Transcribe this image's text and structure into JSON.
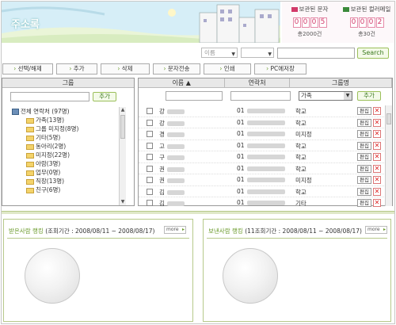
{
  "app": {
    "title": "주소록"
  },
  "counters": [
    {
      "label": "보관된 문자",
      "digits": [
        "0",
        "0",
        "0",
        "5"
      ],
      "summary": "총2000건"
    },
    {
      "label": "보관된 컬러메일",
      "digits": [
        "0",
        "0",
        "0",
        "2"
      ],
      "summary": "총30건"
    }
  ],
  "search": {
    "field_selected": "이름",
    "type_selected": "",
    "query": "",
    "button": "Search"
  },
  "toolbar": [
    "선택/해제",
    "추가",
    "삭제",
    "문자전송",
    "인쇄",
    "PC에저장"
  ],
  "group_panel": {
    "header": "그룹",
    "add_button": "추가",
    "root": "전체 연락처 (97명)",
    "groups": [
      "가족(13명)",
      "그룹 미지정(8명)",
      "기타(5명)",
      "동아리(2명)",
      "미지정(22명)",
      "아람(3명)",
      "업무(0명)",
      "직장(13명)",
      "친구(6명)"
    ]
  },
  "contacts": {
    "columns": [
      "이름 ▲",
      "연락처",
      "그룹명"
    ],
    "group_filter": "가족",
    "add_button": "추가",
    "edit_label": "편집",
    "delete_label": "✕",
    "rows": [
      {
        "name": "강",
        "phone": "01",
        "group": "학교"
      },
      {
        "name": "강",
        "phone": "01",
        "group": "학교"
      },
      {
        "name": "경",
        "phone": "01",
        "group": "미지정"
      },
      {
        "name": "고",
        "phone": "01",
        "group": "학교"
      },
      {
        "name": "구",
        "phone": "01",
        "group": "학교"
      },
      {
        "name": "권",
        "phone": "01",
        "group": "학교"
      },
      {
        "name": "권",
        "phone": "01",
        "group": "미지정"
      },
      {
        "name": "김",
        "phone": "01",
        "group": "학교"
      },
      {
        "name": "김",
        "phone": "01",
        "group": "기타"
      }
    ]
  },
  "rankings": [
    {
      "title": "받은사람 랭킹",
      "period": "(조회기간 : 2008/08/11 ~ 2008/08/17)",
      "more": "more"
    },
    {
      "title": "보낸사람 랭킹",
      "period": "(11조회기간 : 2008/08/11 ~ 2008/08/17)",
      "more": "more"
    }
  ],
  "colors": {
    "accent_green": "#6a9a2a",
    "counter_pink": "#d23a6a",
    "border": "#999999"
  }
}
